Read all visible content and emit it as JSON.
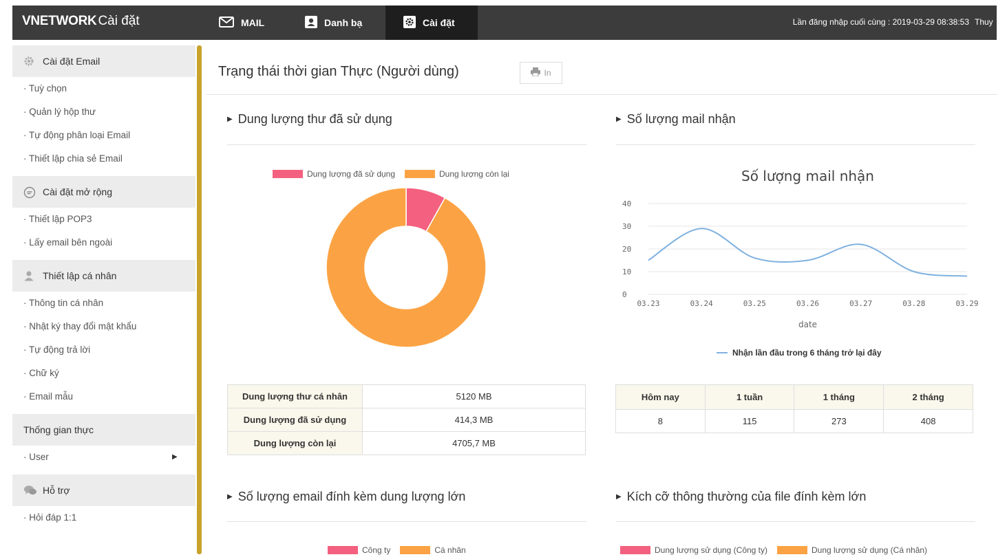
{
  "topbar": {
    "brand_main": "VNETWORK",
    "brand_sub": "Cài đặt",
    "nav": {
      "mail": "MAIL",
      "contacts": "Danh bạ",
      "settings": "Cài đặt"
    },
    "last_login": "Lần đăng nhập cuối cùng : 2019-03-29 08:38:53",
    "user": "Thuy"
  },
  "sidebar": {
    "email_settings": {
      "title": "Cài đặt Email",
      "items": [
        "· Tuỳ chọn",
        "· Quản lý hộp thư",
        "· Tự động phân loại Email",
        "· Thiết lập chia sẻ Email"
      ]
    },
    "extended": {
      "title": "Cài đặt mở rộng",
      "items": [
        "· Thiết lập POP3",
        "· Lấy email bên ngoài"
      ]
    },
    "personal": {
      "title": "Thiết lập cá nhân",
      "items": [
        "· Thông tin cá nhân",
        "· Nhật ký thay đổi mật khẩu",
        "· Tự động trả lời",
        "· Chữ ký",
        "· Email mẫu"
      ]
    },
    "realtime": {
      "title": "Thống gian thực",
      "items": [
        "· User"
      ]
    },
    "support": {
      "title": "Hỗ trợ",
      "items": [
        "· Hỏi đáp 1:1"
      ]
    }
  },
  "content": {
    "page_title": "Trạng thái thời gian Thực (Người dùng)",
    "print_label": "In",
    "panels": {
      "usage": {
        "heading": "Dung lượng thư đã sử dụng",
        "legend": [
          "Dung lượng đã sử dụng",
          "Dung lượng còn lại"
        ],
        "rows": [
          {
            "k": "Dung lượng thư cá nhân",
            "v": "5120 MB"
          },
          {
            "k": "Dung lượng đã sử dụng",
            "v": "414,3 MB"
          },
          {
            "k": "Dung lượng còn lại",
            "v": "4705,7 MB"
          }
        ]
      },
      "mail_count": {
        "heading": "Số lượng mail nhận",
        "headers": [
          "Hôm nay",
          "1 tuần",
          "1 tháng",
          "2 tháng"
        ],
        "values": [
          "8",
          "115",
          "273",
          "408"
        ]
      },
      "attachments_count": {
        "heading": "Số lượng email đính kèm dung lượng lớn",
        "legend": [
          "Công ty",
          "Cá nhân"
        ]
      },
      "attachments_size": {
        "heading": "Kích cỡ thông thường của file đính kèm lớn",
        "legend": [
          "Dung lượng sử dụng (Công ty)",
          "Dung lượng sử dụng (Cá nhân)"
        ]
      }
    }
  },
  "colors": {
    "used": "#f4607f",
    "remaining": "#fba344",
    "line": "#7fb1df",
    "accent": "#c8a22a"
  },
  "chart_data": [
    {
      "type": "pie",
      "variant": "donut",
      "categories": [
        "Dung lượng đã sử dụng",
        "Dung lượng còn lại"
      ],
      "values": [
        414.3,
        4705.7
      ],
      "title": "",
      "legend": "top"
    },
    {
      "type": "line",
      "title": "Số lượng mail nhận",
      "xlabel": "date",
      "ylabel": "",
      "x": [
        "03.23",
        "03.24",
        "03.25",
        "03.26",
        "03.27",
        "03.28",
        "03.29"
      ],
      "series": [
        {
          "name": "Nhận lần đầu trong 6 tháng trở lại đây",
          "values": [
            15,
            29,
            16,
            15,
            22,
            10,
            8
          ]
        }
      ],
      "ylim": [
        0,
        40
      ],
      "yticks": [
        0,
        10,
        20,
        30,
        40
      ],
      "grid": true,
      "legend": "bottom"
    }
  ]
}
